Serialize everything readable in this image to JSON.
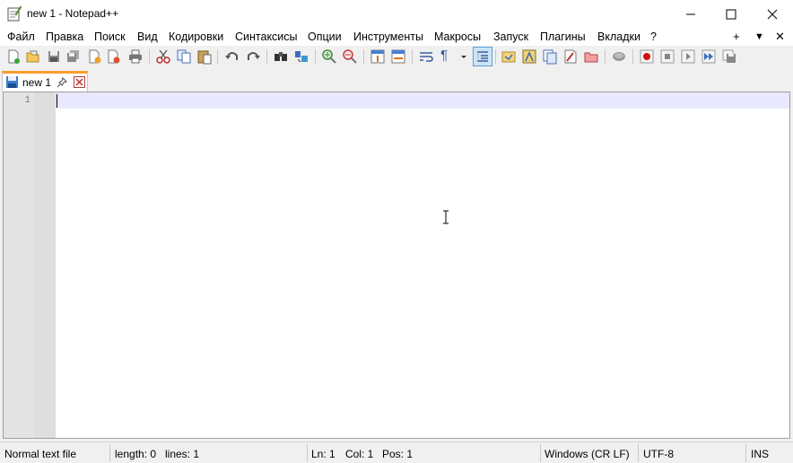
{
  "window": {
    "title": "new 1 - Notepad++"
  },
  "menu": {
    "items": [
      "Файл",
      "Правка",
      "Поиск",
      "Вид",
      "Кодировки",
      "Синтаксисы",
      "Опции",
      "Инструменты",
      "Макросы",
      "Запуск",
      "Плагины",
      "Вкладки",
      "?"
    ],
    "right": {
      "plus": "+",
      "down": "▼",
      "close": "✕"
    }
  },
  "toolbar": {
    "icons": [
      "new-file-icon",
      "open-file-icon",
      "save-icon",
      "save-all-icon",
      "close-icon",
      "close-all-icon",
      "print-icon",
      "cut-icon",
      "copy-icon",
      "paste-icon",
      "undo-icon",
      "redo-icon",
      "find-icon",
      "replace-icon",
      "zoom-in-icon",
      "zoom-out-icon",
      "sync-vertical-icon",
      "sync-horizontal-icon",
      "word-wrap-icon",
      "show-all-chars-icon",
      "indent-guide-icon",
      "user-language-icon",
      "document-map-icon",
      "function-list-icon",
      "folder-workspace-icon",
      "monitoring-icon",
      "record-macro-icon",
      "stop-record-icon",
      "playback-icon",
      "run-macro-multiple-icon",
      "save-macro-icon"
    ],
    "active": "indent-guide-icon"
  },
  "tabs": [
    {
      "label": "new 1"
    }
  ],
  "editor": {
    "line_numbers": [
      "1"
    ],
    "content": ""
  },
  "status": {
    "file_type": "Normal text file",
    "length": "length: 0",
    "lines": "lines: 1",
    "ln": "Ln: 1",
    "col": "Col: 1",
    "pos": "Pos: 1",
    "eol": "Windows (CR LF)",
    "encoding": "UTF-8",
    "mode": "INS"
  },
  "colors": {
    "tab_accent": "#fa9e2c",
    "caret_line": "#e8e8ff",
    "gutter": "#e4e4e4"
  }
}
